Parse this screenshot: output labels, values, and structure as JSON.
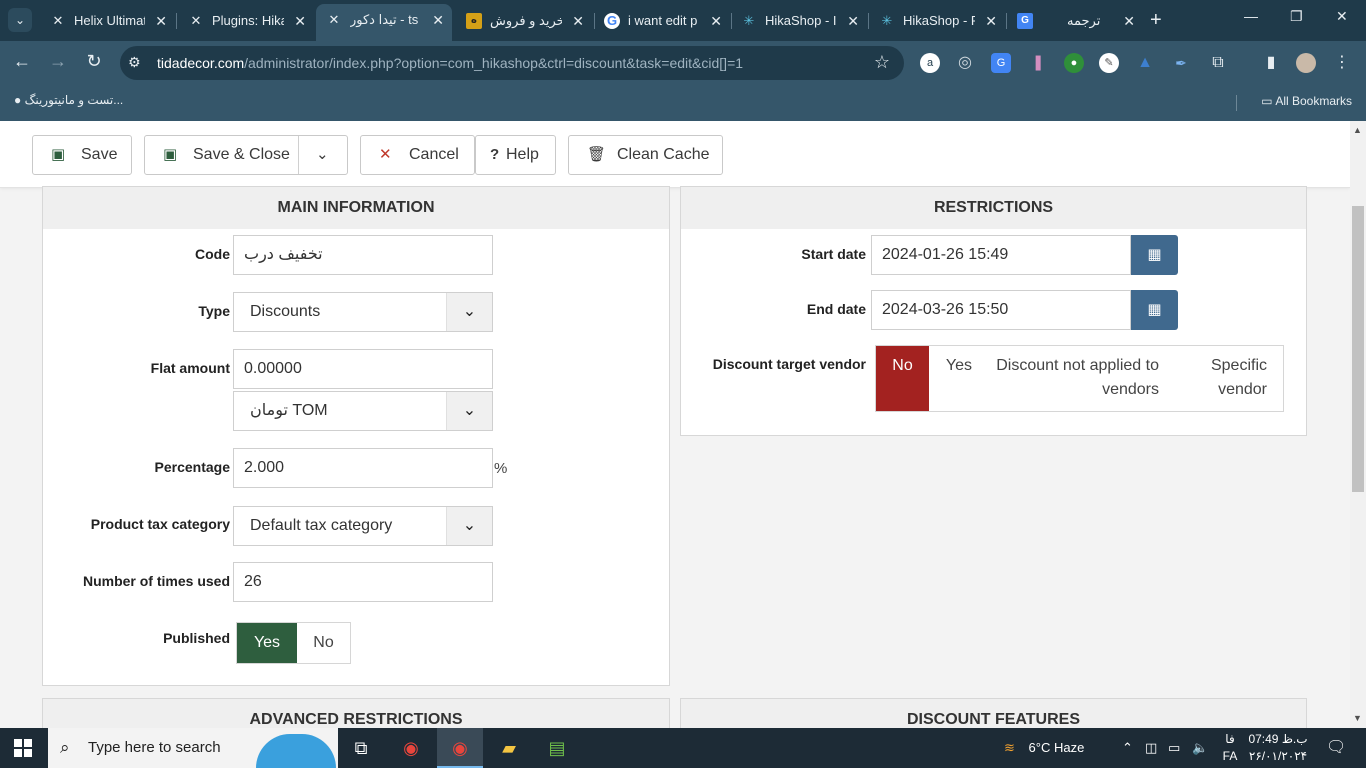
{
  "browser": {
    "tabs": [
      {
        "title": "Helix Ultimat",
        "icon": "joomla-icon"
      },
      {
        "title": "Plugins: Hika",
        "icon": "joomla-icon"
      },
      {
        "title": "تیدا دکور - ts",
        "icon": "joomla-icon",
        "active": true
      },
      {
        "title": "خرید و فروش",
        "icon": "site-icon"
      },
      {
        "title": "i want edit p",
        "icon": "google-icon"
      },
      {
        "title": "HikaShop - I",
        "icon": "hikashop-icon"
      },
      {
        "title": "HikaShop - F",
        "icon": "hikashop-icon"
      },
      {
        "title": "ترجمه",
        "icon": "google-translate-icon"
      }
    ],
    "url_host": "tidadecor.com",
    "url_path": "/administrator/index.php?option=com_hikashop&ctrl=discount&task=edit&cid[]=1",
    "bookmark_item": "تست و مانیتورینگ...",
    "all_bookmarks": "All Bookmarks"
  },
  "actions": {
    "save": "Save",
    "save_close": "Save & Close",
    "cancel": "Cancel",
    "help": "Help",
    "clean_cache": "Clean Cache"
  },
  "main_info": {
    "title": "MAIN INFORMATION",
    "code_label": "Code",
    "code_value": "تخفیف درب",
    "type_label": "Type",
    "type_value": "Discounts",
    "flat_amount_label": "Flat amount",
    "flat_amount_value": "0.00000",
    "currency_value": "تومان TOM",
    "percentage_label": "Percentage",
    "percentage_value": "2.000",
    "percentage_suffix": "%",
    "tax_label": "Product tax category",
    "tax_value": "Default tax category",
    "times_used_label": "Number of times used",
    "times_used_value": "26",
    "published_label": "Published",
    "published_yes": "Yes",
    "published_no": "No",
    "published_selected": "Yes"
  },
  "restrictions": {
    "title": "RESTRICTIONS",
    "start_label": "Start date",
    "start_value": "2024-01-26 15:49",
    "end_label": "End date",
    "end_value": "2024-03-26 15:50",
    "vendor_label": "Discount target vendor",
    "vendor_options": [
      "No",
      "Yes",
      "Discount not applied to vendors",
      "Specific vendor"
    ],
    "vendor_selected": "No"
  },
  "sections_below": {
    "advanced": "ADVANCED RESTRICTIONS",
    "features": "DISCOUNT FEATURES"
  },
  "taskbar": {
    "search_placeholder": "Type here to search",
    "weather": "6°C  Haze",
    "lang_top": "فا",
    "lang_bottom": "FA",
    "time": "07:49 ب.ظ",
    "date": "۲۶/۰۱/۲۰۲۴"
  },
  "colors": {
    "chrome_dark": "#1f3a4a",
    "chrome_light": "#35566a",
    "published_yes": "#2e5e3e",
    "vendor_no": "#a32220",
    "date_button": "#40698e"
  }
}
